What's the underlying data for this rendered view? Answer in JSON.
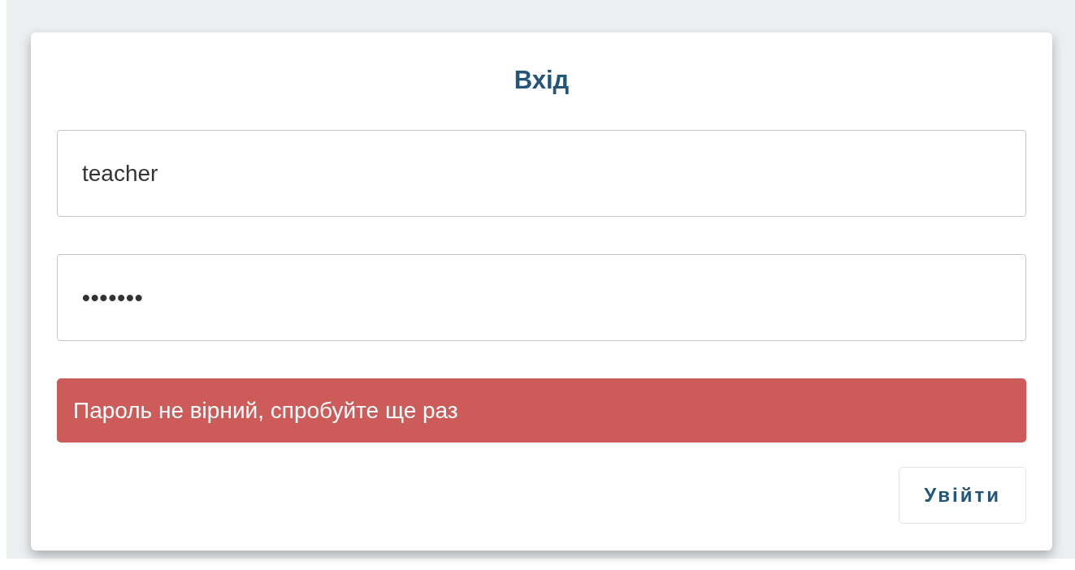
{
  "title": "Вхід",
  "fields": [
    {
      "value": "teacher",
      "kind": "text"
    },
    {
      "value": "•••••••",
      "kind": "password"
    }
  ],
  "alert": {
    "text": "Пароль не вірний, спробуйте ще раз"
  },
  "buttons": [
    "Увійти"
  ]
}
